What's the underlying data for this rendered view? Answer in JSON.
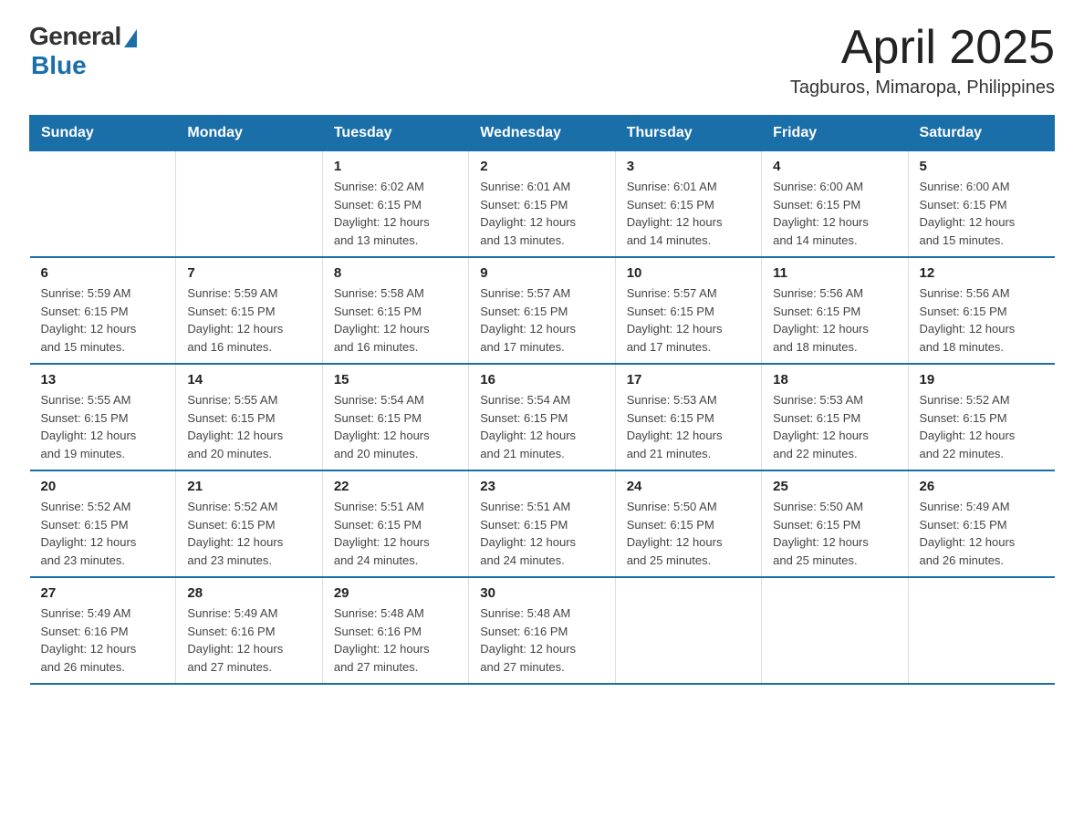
{
  "logo": {
    "general": "General",
    "blue": "Blue"
  },
  "title": "April 2025",
  "location": "Tagburos, Mimaropa, Philippines",
  "days_header": [
    "Sunday",
    "Monday",
    "Tuesday",
    "Wednesday",
    "Thursday",
    "Friday",
    "Saturday"
  ],
  "weeks": [
    [
      {
        "day": "",
        "info": ""
      },
      {
        "day": "",
        "info": ""
      },
      {
        "day": "1",
        "info": "Sunrise: 6:02 AM\nSunset: 6:15 PM\nDaylight: 12 hours\nand 13 minutes."
      },
      {
        "day": "2",
        "info": "Sunrise: 6:01 AM\nSunset: 6:15 PM\nDaylight: 12 hours\nand 13 minutes."
      },
      {
        "day": "3",
        "info": "Sunrise: 6:01 AM\nSunset: 6:15 PM\nDaylight: 12 hours\nand 14 minutes."
      },
      {
        "day": "4",
        "info": "Sunrise: 6:00 AM\nSunset: 6:15 PM\nDaylight: 12 hours\nand 14 minutes."
      },
      {
        "day": "5",
        "info": "Sunrise: 6:00 AM\nSunset: 6:15 PM\nDaylight: 12 hours\nand 15 minutes."
      }
    ],
    [
      {
        "day": "6",
        "info": "Sunrise: 5:59 AM\nSunset: 6:15 PM\nDaylight: 12 hours\nand 15 minutes."
      },
      {
        "day": "7",
        "info": "Sunrise: 5:59 AM\nSunset: 6:15 PM\nDaylight: 12 hours\nand 16 minutes."
      },
      {
        "day": "8",
        "info": "Sunrise: 5:58 AM\nSunset: 6:15 PM\nDaylight: 12 hours\nand 16 minutes."
      },
      {
        "day": "9",
        "info": "Sunrise: 5:57 AM\nSunset: 6:15 PM\nDaylight: 12 hours\nand 17 minutes."
      },
      {
        "day": "10",
        "info": "Sunrise: 5:57 AM\nSunset: 6:15 PM\nDaylight: 12 hours\nand 17 minutes."
      },
      {
        "day": "11",
        "info": "Sunrise: 5:56 AM\nSunset: 6:15 PM\nDaylight: 12 hours\nand 18 minutes."
      },
      {
        "day": "12",
        "info": "Sunrise: 5:56 AM\nSunset: 6:15 PM\nDaylight: 12 hours\nand 18 minutes."
      }
    ],
    [
      {
        "day": "13",
        "info": "Sunrise: 5:55 AM\nSunset: 6:15 PM\nDaylight: 12 hours\nand 19 minutes."
      },
      {
        "day": "14",
        "info": "Sunrise: 5:55 AM\nSunset: 6:15 PM\nDaylight: 12 hours\nand 20 minutes."
      },
      {
        "day": "15",
        "info": "Sunrise: 5:54 AM\nSunset: 6:15 PM\nDaylight: 12 hours\nand 20 minutes."
      },
      {
        "day": "16",
        "info": "Sunrise: 5:54 AM\nSunset: 6:15 PM\nDaylight: 12 hours\nand 21 minutes."
      },
      {
        "day": "17",
        "info": "Sunrise: 5:53 AM\nSunset: 6:15 PM\nDaylight: 12 hours\nand 21 minutes."
      },
      {
        "day": "18",
        "info": "Sunrise: 5:53 AM\nSunset: 6:15 PM\nDaylight: 12 hours\nand 22 minutes."
      },
      {
        "day": "19",
        "info": "Sunrise: 5:52 AM\nSunset: 6:15 PM\nDaylight: 12 hours\nand 22 minutes."
      }
    ],
    [
      {
        "day": "20",
        "info": "Sunrise: 5:52 AM\nSunset: 6:15 PM\nDaylight: 12 hours\nand 23 minutes."
      },
      {
        "day": "21",
        "info": "Sunrise: 5:52 AM\nSunset: 6:15 PM\nDaylight: 12 hours\nand 23 minutes."
      },
      {
        "day": "22",
        "info": "Sunrise: 5:51 AM\nSunset: 6:15 PM\nDaylight: 12 hours\nand 24 minutes."
      },
      {
        "day": "23",
        "info": "Sunrise: 5:51 AM\nSunset: 6:15 PM\nDaylight: 12 hours\nand 24 minutes."
      },
      {
        "day": "24",
        "info": "Sunrise: 5:50 AM\nSunset: 6:15 PM\nDaylight: 12 hours\nand 25 minutes."
      },
      {
        "day": "25",
        "info": "Sunrise: 5:50 AM\nSunset: 6:15 PM\nDaylight: 12 hours\nand 25 minutes."
      },
      {
        "day": "26",
        "info": "Sunrise: 5:49 AM\nSunset: 6:15 PM\nDaylight: 12 hours\nand 26 minutes."
      }
    ],
    [
      {
        "day": "27",
        "info": "Sunrise: 5:49 AM\nSunset: 6:16 PM\nDaylight: 12 hours\nand 26 minutes."
      },
      {
        "day": "28",
        "info": "Sunrise: 5:49 AM\nSunset: 6:16 PM\nDaylight: 12 hours\nand 27 minutes."
      },
      {
        "day": "29",
        "info": "Sunrise: 5:48 AM\nSunset: 6:16 PM\nDaylight: 12 hours\nand 27 minutes."
      },
      {
        "day": "30",
        "info": "Sunrise: 5:48 AM\nSunset: 6:16 PM\nDaylight: 12 hours\nand 27 minutes."
      },
      {
        "day": "",
        "info": ""
      },
      {
        "day": "",
        "info": ""
      },
      {
        "day": "",
        "info": ""
      }
    ]
  ]
}
